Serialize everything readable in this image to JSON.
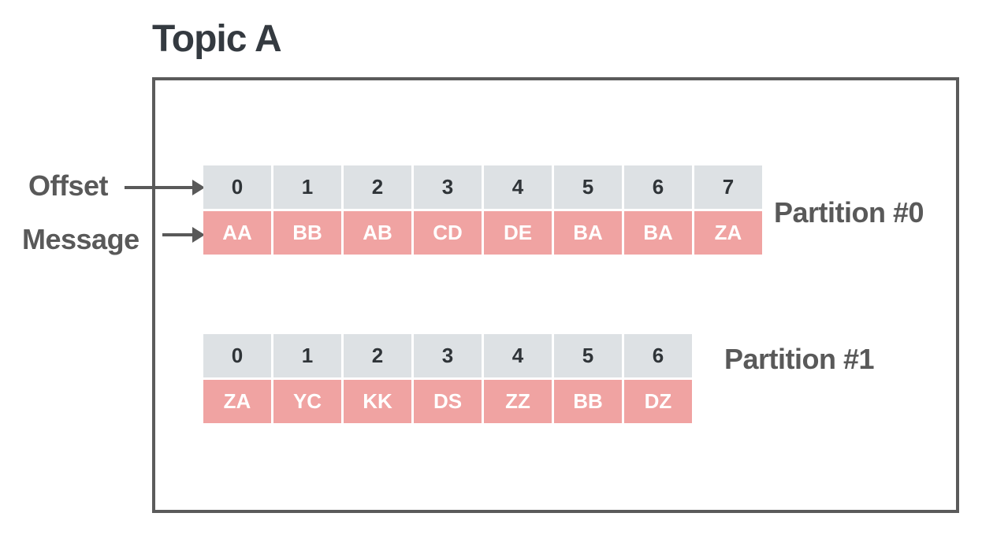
{
  "title": "Topic A",
  "labels": {
    "offset": "Offset",
    "message": "Message"
  },
  "partitions": [
    {
      "name": "Partition #0",
      "offsets": [
        "0",
        "1",
        "2",
        "3",
        "4",
        "5",
        "6",
        "7"
      ],
      "messages": [
        "AA",
        "BB",
        "AB",
        "CD",
        "DE",
        "BA",
        "BA",
        "ZA"
      ]
    },
    {
      "name": "Partition #1",
      "offsets": [
        "0",
        "1",
        "2",
        "3",
        "4",
        "5",
        "6"
      ],
      "messages": [
        "ZA",
        "YC",
        "KK",
        "DS",
        "ZZ",
        "BB",
        "DZ"
      ]
    }
  ],
  "colors": {
    "offset_bg": "#dde1e4",
    "message_bg": "#f0a3a2",
    "border": "#5b5b5b",
    "text_dark": "#343a40",
    "text_gray": "#595959"
  }
}
